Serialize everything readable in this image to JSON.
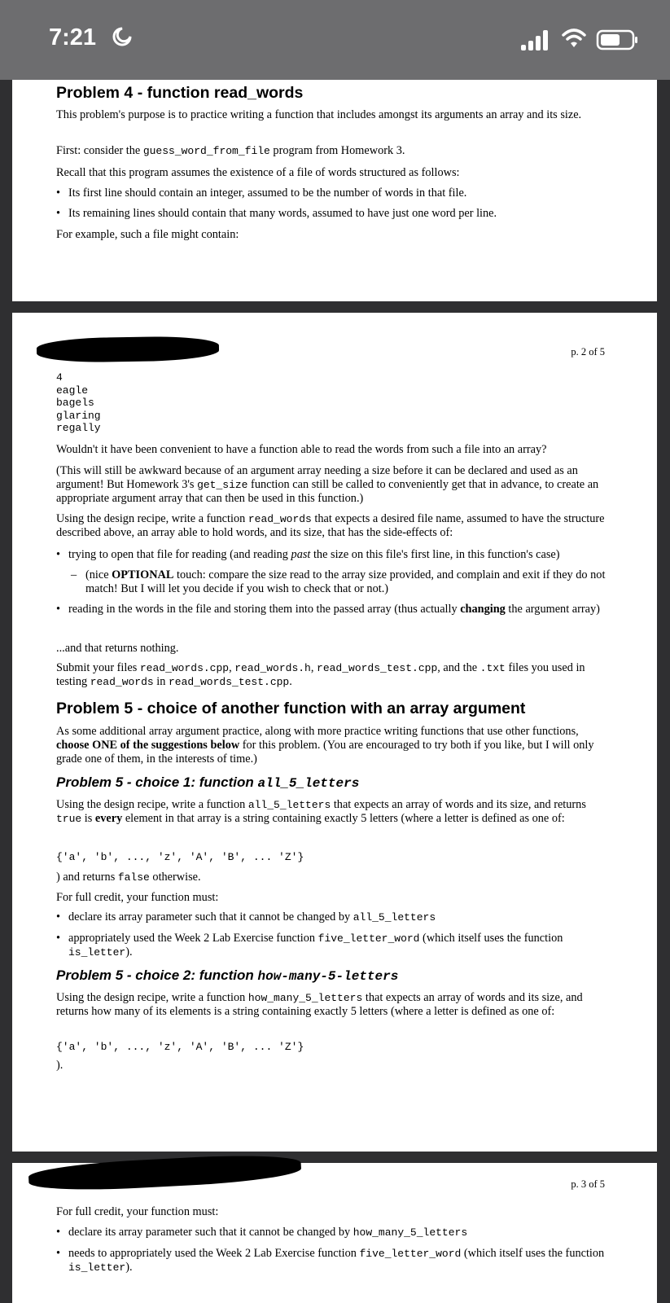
{
  "status_bar": {
    "time": "7:21"
  },
  "problem4": {
    "title": "Problem 4 - function read_words",
    "intro": "This problem's purpose is to practice writing a function that includes amongst its arguments an array and its size.",
    "first_pre": "First: consider the ",
    "first_code": "guess_word_from_file",
    "first_post": " program from Homework 3.",
    "recall": "Recall that this program assumes the existence of a file of words structured as follows:",
    "bullet1": "Its first line should contain an integer, assumed to be the number of words in that file.",
    "bullet2": "Its remaining lines should contain that many words, assumed to have just one word per line.",
    "example": "For example, such a file might contain:"
  },
  "page2": {
    "page_number": "p. 2 of 5",
    "file_lines": [
      "4",
      "eagle",
      "bagels",
      "glaring",
      "regally"
    ],
    "wouldnt": "Wouldn't it have been convenient to have a function able to read the words from such a file into an array?",
    "paren_1": "(This will still be awkward because of an argument array needing a size before it can be declared and used as an argument! But Homework 3's ",
    "paren_code": "get_size",
    "paren_2": " function can still be called to conveniently get that in advance, to create an appropriate argument array that can then be used in this function.)",
    "using_1": "Using the design recipe, write a function ",
    "using_code": "read_words",
    "using_2": " that expects a desired file name, assumed to have the structure described above, an array able to hold words, and its size, that has the side-effects of:",
    "b1_pre": "trying to open that file for reading (and reading ",
    "b1_em": "past",
    "b1_post": " the size on this file's first line, in this function's case)",
    "sub_pre": "(nice ",
    "sub_strong": "OPTIONAL",
    "sub_post": " touch: compare the size read to the array size provided, and complain and exit if they do not match! But I will let you decide if you wish to check that or not.)",
    "b2_pre": "reading in the words in the file and storing them into the passed array (thus actually ",
    "b2_strong": "changing",
    "b2_post": " the argument array)",
    "returns_nothing": "...and that returns nothing.",
    "submit_1": "Submit your files ",
    "submit_c1": "read_words.cpp",
    "submit_s1": ", ",
    "submit_c2": "read_words.h",
    "submit_s2": ", ",
    "submit_c3": "read_words_test.cpp",
    "submit_s3": ", and the ",
    "submit_c4": ".txt",
    "submit_s4": " files you used in testing ",
    "submit_c5": "read_words",
    "submit_s5": " in ",
    "submit_c6": "read_words_test.cpp",
    "submit_s6": ".",
    "p5_title": "Problem 5 - choice of another function with an array argument",
    "p5_intro_1": "As some additional array argument practice, along with more practice writing functions that use other functions, ",
    "p5_intro_strong": "choose ONE of the suggestions below",
    "p5_intro_2": " for this problem. (You are encouraged to try both if you like, but I will only grade one of them, in the interests of time.)",
    "c1_title_pre": "Problem 5 - choice 1: function ",
    "c1_title_code": "all_5_letters",
    "c1_text_1": "Using the design recipe, write a function ",
    "c1_text_code": "all_5_letters",
    "c1_text_2": " that expects an array of words and its size, and returns ",
    "c1_text_code2": "true",
    "c1_text_3": " is ",
    "c1_text_strong": "every",
    "c1_text_4": " element in that array is a string containing exactly 5 letters (where a letter is defined as one of:",
    "set_line": "{'a', 'b', ..., 'z', 'A', 'B', ... 'Z'}",
    "c1_false_1": ") and returns ",
    "c1_false_code": "false",
    "c1_false_2": " otherwise.",
    "full_credit": "For full credit, your function must:",
    "c1_b1_pre": "declare its array parameter such that it cannot be changed by ",
    "c1_b1_code": "all_5_letters",
    "c1_b2_pre": "appropriately used the Week 2 Lab Exercise function ",
    "c1_b2_code": "five_letter_word",
    "c1_b2_mid": " (which itself uses the function ",
    "c1_b2_code2": "is_letter",
    "c1_b2_post": ").",
    "c2_title_pre": "Problem 5 - choice 2: function ",
    "c2_title_code": "how-many-5-letters",
    "c2_text_1": "Using the design recipe, write a function ",
    "c2_text_code": "how_many_5_letters",
    "c2_text_2": " that expects an array of words and its size, and returns how many of its elements is a string containing exactly 5 letters (where a letter is defined as one of:",
    "c2_close": ")."
  },
  "page3": {
    "page_number": "p. 3 of 5",
    "full_credit": "For full credit, your function must:",
    "b1_pre": "declare its array parameter such that it cannot be changed by ",
    "b1_code": "how_many_5_letters",
    "b2_pre": "needs to appropriately used the Week 2 Lab Exercise function ",
    "b2_code": "five_letter_word",
    "b2_mid": " (which itself uses the function ",
    "b2_code2": "is_letter",
    "b2_post": ")."
  }
}
